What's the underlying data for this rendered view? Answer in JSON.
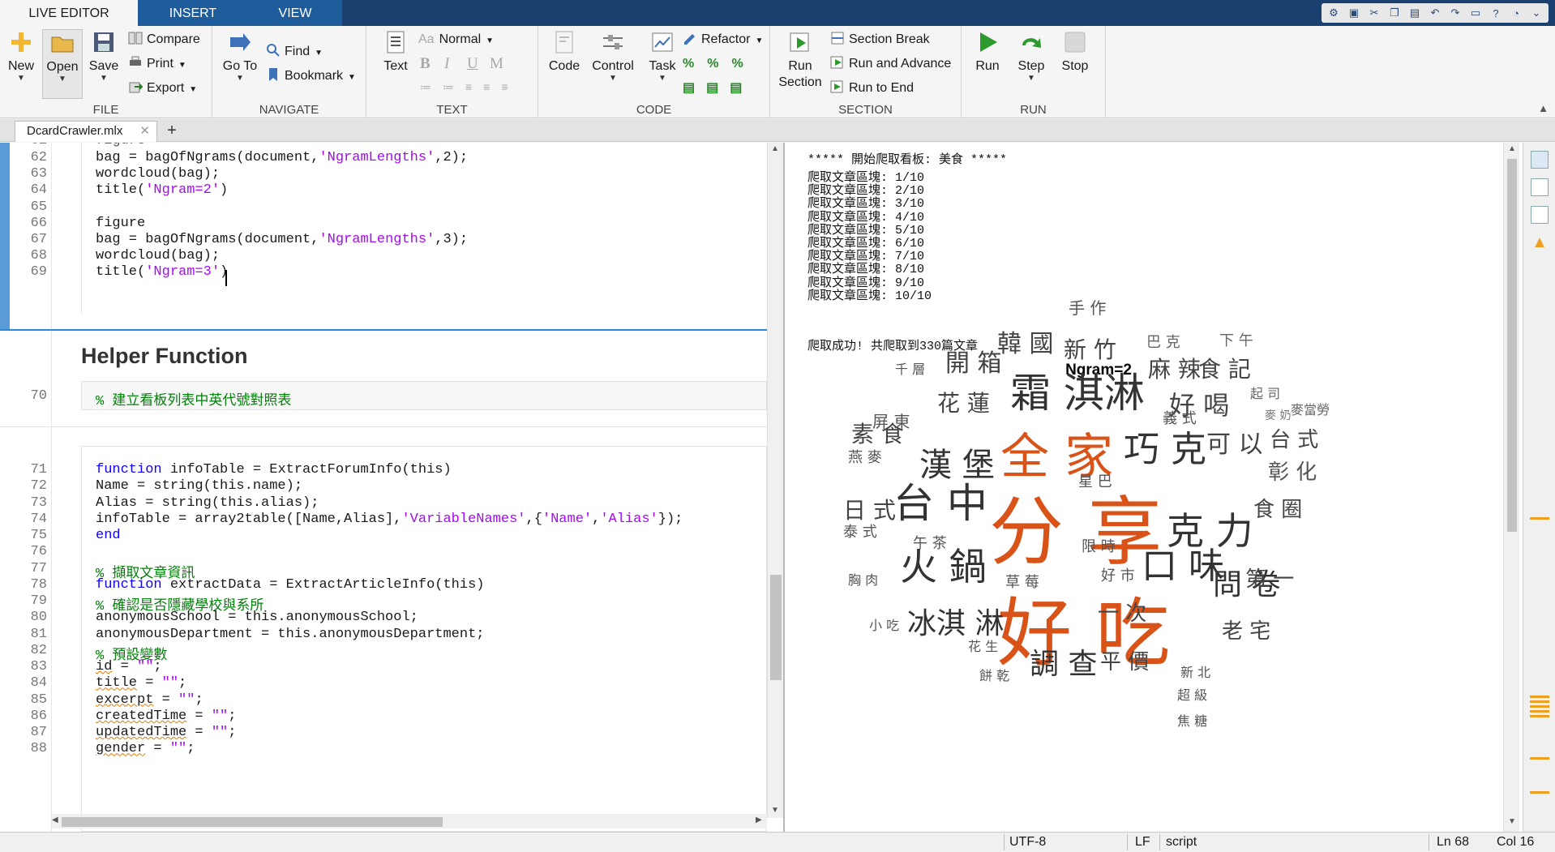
{
  "tabs": [
    {
      "label": "LIVE EDITOR",
      "active": true
    },
    {
      "label": "INSERT",
      "active": false
    },
    {
      "label": "VIEW",
      "active": false
    }
  ],
  "ribbon": {
    "file": {
      "label": "FILE",
      "new": "New",
      "open": "Open",
      "save": "Save",
      "compare": "Compare",
      "print": "Print",
      "export": "Export"
    },
    "navigate": {
      "label": "NAVIGATE",
      "goto": "Go To",
      "find": "Find",
      "bookmark": "Bookmark"
    },
    "text": {
      "label": "TEXT",
      "text": "Text",
      "style": "Normal",
      "bold": "B",
      "italic": "I",
      "underline": "U",
      "mono": "M"
    },
    "code": {
      "label": "CODE",
      "code": "Code",
      "control": "Control",
      "task": "Task",
      "refactor": "Refactor"
    },
    "section": {
      "label": "SECTION",
      "run_section_1": "Run",
      "run_section_2": "Section",
      "section_break": "Section Break",
      "run_advance": "Run and Advance",
      "run_end": "Run to End"
    },
    "run": {
      "label": "RUN",
      "run": "Run",
      "step": "Step",
      "stop": "Stop"
    }
  },
  "file_tab": {
    "name": "DcardCrawler.mlx"
  },
  "editor": {
    "partial_line": "figure",
    "lines_a": [
      {
        "n": "62",
        "parts": [
          {
            "t": "bag = bagOfNgrams(document,",
            "c": ""
          },
          {
            "t": "'NgramLengths'",
            "c": "str"
          },
          {
            "t": ",2);",
            "c": ""
          }
        ]
      },
      {
        "n": "63",
        "parts": [
          {
            "t": "wordcloud(bag);",
            "c": ""
          }
        ]
      },
      {
        "n": "64",
        "parts": [
          {
            "t": "title(",
            "c": ""
          },
          {
            "t": "'Ngram=2'",
            "c": "str"
          },
          {
            "t": ")",
            "c": ""
          }
        ]
      },
      {
        "n": "65",
        "parts": []
      },
      {
        "n": "66",
        "parts": [
          {
            "t": "figure",
            "c": ""
          }
        ]
      },
      {
        "n": "67",
        "parts": [
          {
            "t": "bag = bagOfNgrams(document,",
            "c": ""
          },
          {
            "t": "'NgramLengths'",
            "c": "str"
          },
          {
            "t": ",3);",
            "c": ""
          }
        ]
      },
      {
        "n": "68",
        "parts": [
          {
            "t": "wordcloud(bag);",
            "c": ""
          }
        ]
      },
      {
        "n": "69",
        "parts": [
          {
            "t": "title(",
            "c": ""
          },
          {
            "t": "'Ngram=3'",
            "c": "str"
          },
          {
            "t": ")",
            "c": ""
          }
        ]
      }
    ],
    "helper_title": "Helper Function",
    "line_70": {
      "n": "70",
      "text": "% 建立看板列表中英代號對照表"
    },
    "lines_b": [
      {
        "n": "71",
        "parts": [
          {
            "t": "function",
            "c": "kw"
          },
          {
            "t": " infoTable = ExtractForumInfo(this)",
            "c": ""
          }
        ]
      },
      {
        "n": "72",
        "parts": [
          {
            "t": "Name = string(this.name);",
            "c": ""
          }
        ]
      },
      {
        "n": "73",
        "parts": [
          {
            "t": "Alias = string(this.alias);",
            "c": ""
          }
        ]
      },
      {
        "n": "74",
        "parts": [
          {
            "t": "infoTable = array2table([Name,Alias],",
            "c": ""
          },
          {
            "t": "'VariableNames'",
            "c": "str"
          },
          {
            "t": ",{",
            "c": ""
          },
          {
            "t": "'Name'",
            "c": "str"
          },
          {
            "t": ",",
            "c": ""
          },
          {
            "t": "'Alias'",
            "c": "str"
          },
          {
            "t": "});",
            "c": ""
          }
        ]
      },
      {
        "n": "75",
        "parts": [
          {
            "t": "end",
            "c": "kw"
          }
        ]
      },
      {
        "n": "76",
        "parts": []
      },
      {
        "n": "77",
        "parts": [
          {
            "t": "% 擷取文章資訊",
            "c": "cm"
          }
        ]
      },
      {
        "n": "78",
        "parts": [
          {
            "t": "function",
            "c": "kw"
          },
          {
            "t": " extractData = ExtractArticleInfo(this)",
            "c": ""
          }
        ]
      },
      {
        "n": "79",
        "parts": [
          {
            "t": "% 確認是否隱藏學校與系所",
            "c": "cm"
          }
        ]
      },
      {
        "n": "80",
        "parts": [
          {
            "t": "anonymousSchool = this.anonymousSchool;",
            "c": ""
          }
        ]
      },
      {
        "n": "81",
        "parts": [
          {
            "t": "anonymousDepartment = this.anonymousDepartment;",
            "c": ""
          }
        ]
      },
      {
        "n": "82",
        "parts": [
          {
            "t": "% 預設變數",
            "c": "cm"
          }
        ]
      },
      {
        "n": "83",
        "parts": [
          {
            "t": "id",
            "c": "wavy"
          },
          {
            "t": " = ",
            "c": ""
          },
          {
            "t": "\"\"",
            "c": "str"
          },
          {
            "t": ";",
            "c": ""
          }
        ]
      },
      {
        "n": "84",
        "parts": [
          {
            "t": "title",
            "c": "wavy"
          },
          {
            "t": " = ",
            "c": ""
          },
          {
            "t": "\"\"",
            "c": "str"
          },
          {
            "t": ";",
            "c": ""
          }
        ]
      },
      {
        "n": "85",
        "parts": [
          {
            "t": "excerpt",
            "c": "wavy"
          },
          {
            "t": " = ",
            "c": ""
          },
          {
            "t": "\"\"",
            "c": "str"
          },
          {
            "t": ";",
            "c": ""
          }
        ]
      },
      {
        "n": "86",
        "parts": [
          {
            "t": "createdTime",
            "c": "wavy"
          },
          {
            "t": " = ",
            "c": ""
          },
          {
            "t": "\"\"",
            "c": "str"
          },
          {
            "t": ";",
            "c": ""
          }
        ]
      },
      {
        "n": "87",
        "parts": [
          {
            "t": "updatedTime",
            "c": "wavy"
          },
          {
            "t": " = ",
            "c": ""
          },
          {
            "t": "\"\"",
            "c": "str"
          },
          {
            "t": ";",
            "c": ""
          }
        ]
      },
      {
        "n": "88",
        "parts": [
          {
            "t": "gender",
            "c": "wavy"
          },
          {
            "t": " = ",
            "c": ""
          },
          {
            "t": "\"\"",
            "c": "str"
          },
          {
            "t": ";",
            "c": ""
          }
        ]
      }
    ]
  },
  "output": {
    "lines": [
      "***** 開始爬取看板: 美食 *****",
      "爬取文章區塊: 1/10",
      "爬取文章區塊: 2/10",
      "爬取文章區塊: 3/10",
      "爬取文章區塊: 4/10",
      "爬取文章區塊: 5/10",
      "爬取文章區塊: 6/10",
      "爬取文章區塊: 7/10",
      "爬取文章區塊: 8/10",
      "爬取文章區塊: 9/10",
      "爬取文章區塊: 10/10"
    ],
    "success": "爬取成功! 共爬取到330篇文章",
    "wordcloud_title": "Ngram=2",
    "words": [
      {
        "t": "分 享",
        "c": "#d95319"
      },
      {
        "t": "好 吃",
        "c": "#d95319"
      },
      {
        "t": "全 家",
        "c": "#d95319"
      },
      {
        "t": "霜 淇淋",
        "c": "#333"
      },
      {
        "t": "台 中",
        "c": "#333"
      },
      {
        "t": "克 力",
        "c": "#333"
      },
      {
        "t": "火 鍋",
        "c": "#333"
      },
      {
        "t": "口 味",
        "c": "#333"
      },
      {
        "t": "冰淇 淋",
        "c": "#333"
      },
      {
        "t": "巧 克",
        "c": "#333"
      },
      {
        "t": "漢 堡",
        "c": "#333"
      },
      {
        "t": "調 查",
        "c": "#333"
      },
      {
        "t": "問 卷",
        "c": "#333"
      },
      {
        "t": "韓 國",
        "c": "#444"
      },
      {
        "t": "新 竹",
        "c": "#444"
      },
      {
        "t": "開 箱",
        "c": "#444"
      },
      {
        "t": "麻 辣",
        "c": "#444"
      },
      {
        "t": "食 記",
        "c": "#444"
      },
      {
        "t": "好 喝",
        "c": "#444"
      },
      {
        "t": "花 蓮",
        "c": "#444"
      },
      {
        "t": "素 食",
        "c": "#444"
      },
      {
        "t": "可 以",
        "c": "#444"
      },
      {
        "t": "台 式",
        "c": "#444"
      },
      {
        "t": "彰 化",
        "c": "#555"
      },
      {
        "t": "日 式",
        "c": "#444"
      },
      {
        "t": "食 圈",
        "c": "#444"
      },
      {
        "t": "平 價",
        "c": "#444"
      },
      {
        "t": "老 宅",
        "c": "#444"
      },
      {
        "t": "一 次",
        "c": "#444"
      },
      {
        "t": "第 一",
        "c": "#444"
      },
      {
        "t": "手 作",
        "c": "#555"
      },
      {
        "t": "巴 克",
        "c": "#666"
      },
      {
        "t": "下 午",
        "c": "#666"
      },
      {
        "t": "千 層",
        "c": "#555"
      },
      {
        "t": "屏 東",
        "c": "#555"
      },
      {
        "t": "義 式",
        "c": "#555"
      },
      {
        "t": "起 司",
        "c": "#666"
      },
      {
        "t": "麥當勞",
        "c": "#666"
      },
      {
        "t": "麥 奶",
        "c": "#777"
      },
      {
        "t": "燕 麥",
        "c": "#555"
      },
      {
        "t": "星 巴",
        "c": "#555"
      },
      {
        "t": "泰 式",
        "c": "#555"
      },
      {
        "t": "午 茶",
        "c": "#555"
      },
      {
        "t": "限 時",
        "c": "#555"
      },
      {
        "t": "好 市",
        "c": "#555"
      },
      {
        "t": "胸 肉",
        "c": "#555"
      },
      {
        "t": "草 莓",
        "c": "#555"
      },
      {
        "t": "小 吃",
        "c": "#555"
      },
      {
        "t": "花 生",
        "c": "#555"
      },
      {
        "t": "餅 乾",
        "c": "#555"
      },
      {
        "t": "新 北",
        "c": "#555"
      },
      {
        "t": "超 級",
        "c": "#555"
      },
      {
        "t": "焦 糖",
        "c": "#555"
      }
    ]
  },
  "status": {
    "encoding": "UTF-8",
    "eol": "LF",
    "type": "script",
    "ln": "Ln 68",
    "col": "Col 16"
  }
}
